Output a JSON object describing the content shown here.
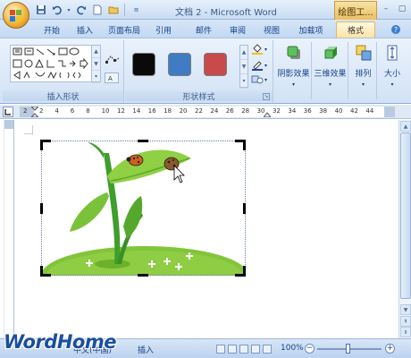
{
  "window": {
    "title": "文档 2 - Microsoft Word",
    "context_tab": "绘图工...",
    "controls": [
      "–",
      "▢",
      "✕"
    ]
  },
  "tabs": [
    {
      "label": "开始"
    },
    {
      "label": "插入"
    },
    {
      "label": "页面布局"
    },
    {
      "label": "引用"
    },
    {
      "label": "邮件"
    },
    {
      "label": "审阅"
    },
    {
      "label": "视图"
    },
    {
      "label": "加载项"
    },
    {
      "label": "格式",
      "active": true
    }
  ],
  "ribbon": {
    "insert_shapes": {
      "label": "插入形状"
    },
    "shape_styles": {
      "label": "形状样式",
      "swatches": [
        "#0a0a0a",
        "#3f7cc4",
        "#c94a4a"
      ]
    },
    "shadow_effects": {
      "label": "阴影效果"
    },
    "threed_effects": {
      "label": "三维效果"
    },
    "arrange": {
      "label": "排列"
    },
    "size": {
      "label": "大小"
    }
  },
  "ruler": {
    "ticks": [
      "2",
      "2",
      "4",
      "6",
      "8",
      "10",
      "12",
      "14",
      "16",
      "18",
      "20",
      "22",
      "24",
      "26",
      "28",
      "30",
      "32",
      "34",
      "36",
      "38",
      "40",
      "42",
      "44"
    ]
  },
  "statusbar": {
    "mode_text": "中文(中国)",
    "insert_mode": "插入",
    "zoom": "100%"
  },
  "watermark": "WordHome",
  "colors": {
    "accent": "#15428b",
    "context_tab": "#eac063",
    "ribbon_bg": "#d2e2f5"
  }
}
